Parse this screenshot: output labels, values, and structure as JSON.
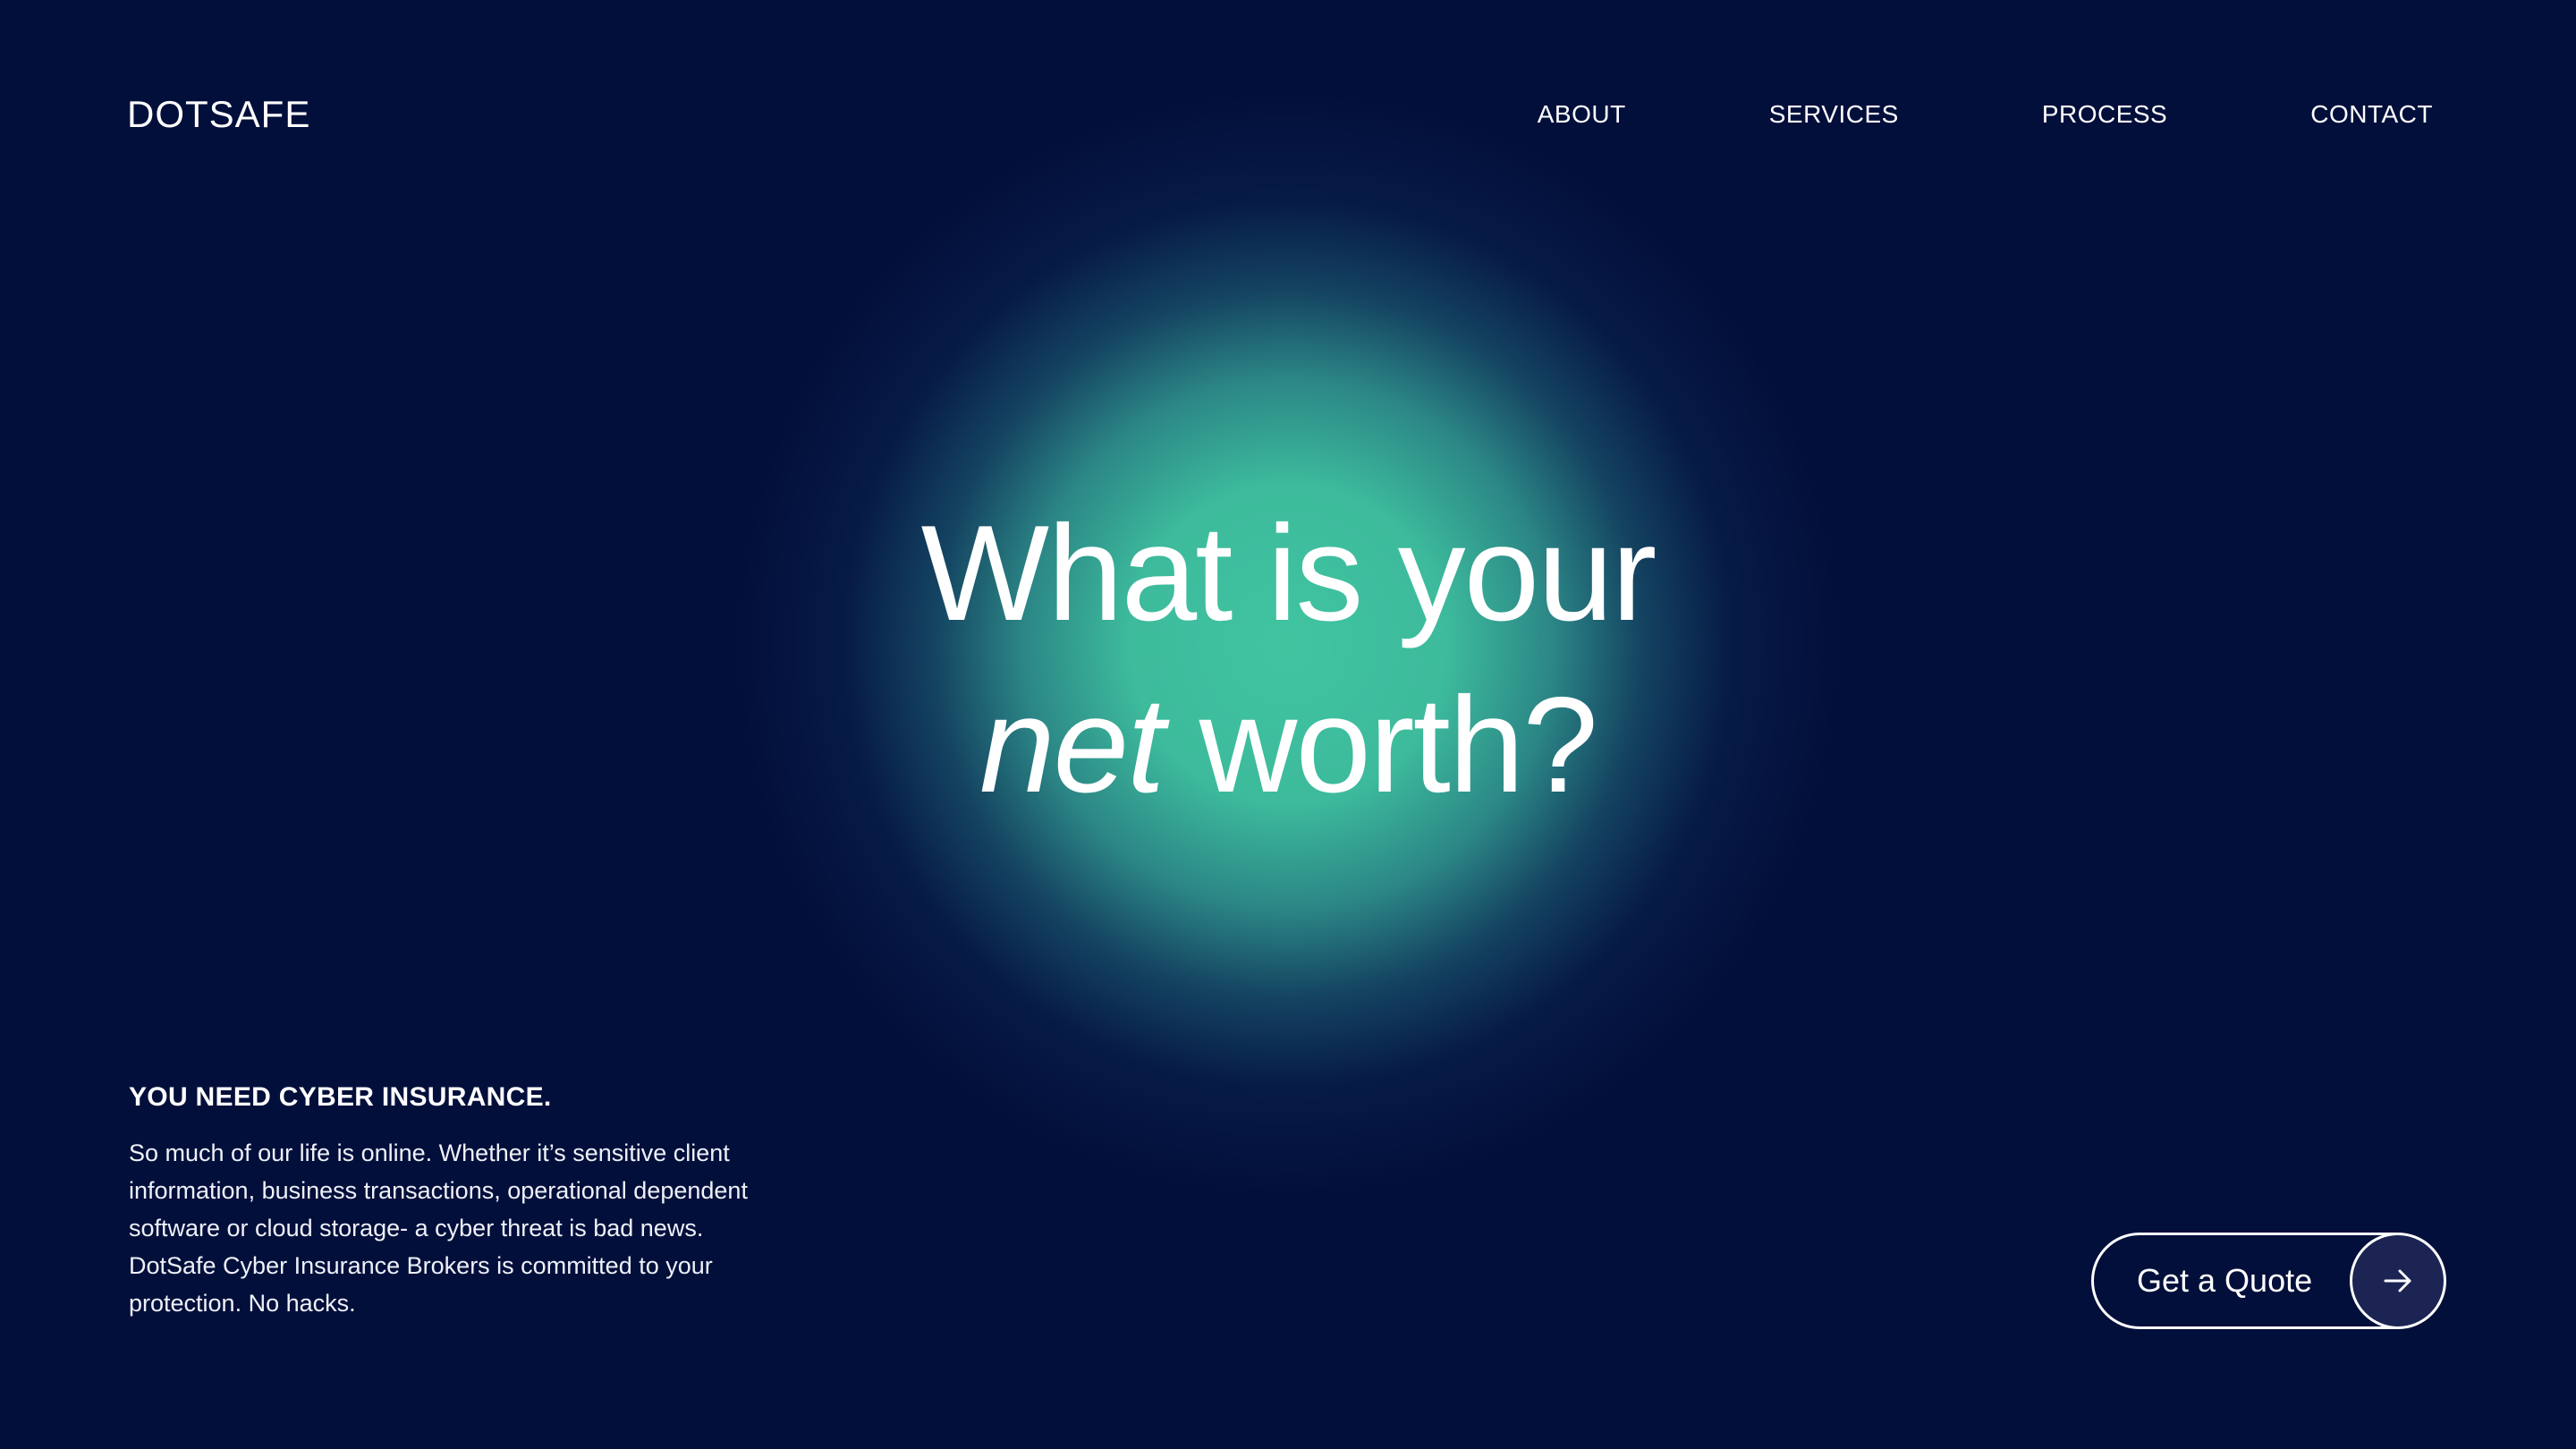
{
  "brand": {
    "logo": "DOTSAFE"
  },
  "nav": {
    "items": [
      "ABOUT",
      "SERVICES",
      "PROCESS",
      "CONTACT"
    ]
  },
  "hero": {
    "line1": "What is your",
    "line2_italic": "net",
    "line2_rest": " worth?"
  },
  "info": {
    "heading": "YOU NEED CYBER INSURANCE.",
    "body": "So much of our life is online. Whether it’s sensitive client information, business transactions, operational dependent software or cloud storage- a cyber threat is bad news. DotSafe Cyber Insurance Brokers is committed to your protection. No hacks."
  },
  "cta": {
    "label": "Get a Quote",
    "icon": "arrow-right-icon"
  },
  "colors": {
    "background": "#030f3b",
    "glow": "#40c4a0",
    "text": "#ffffff",
    "button_circle": "#1b2452"
  }
}
